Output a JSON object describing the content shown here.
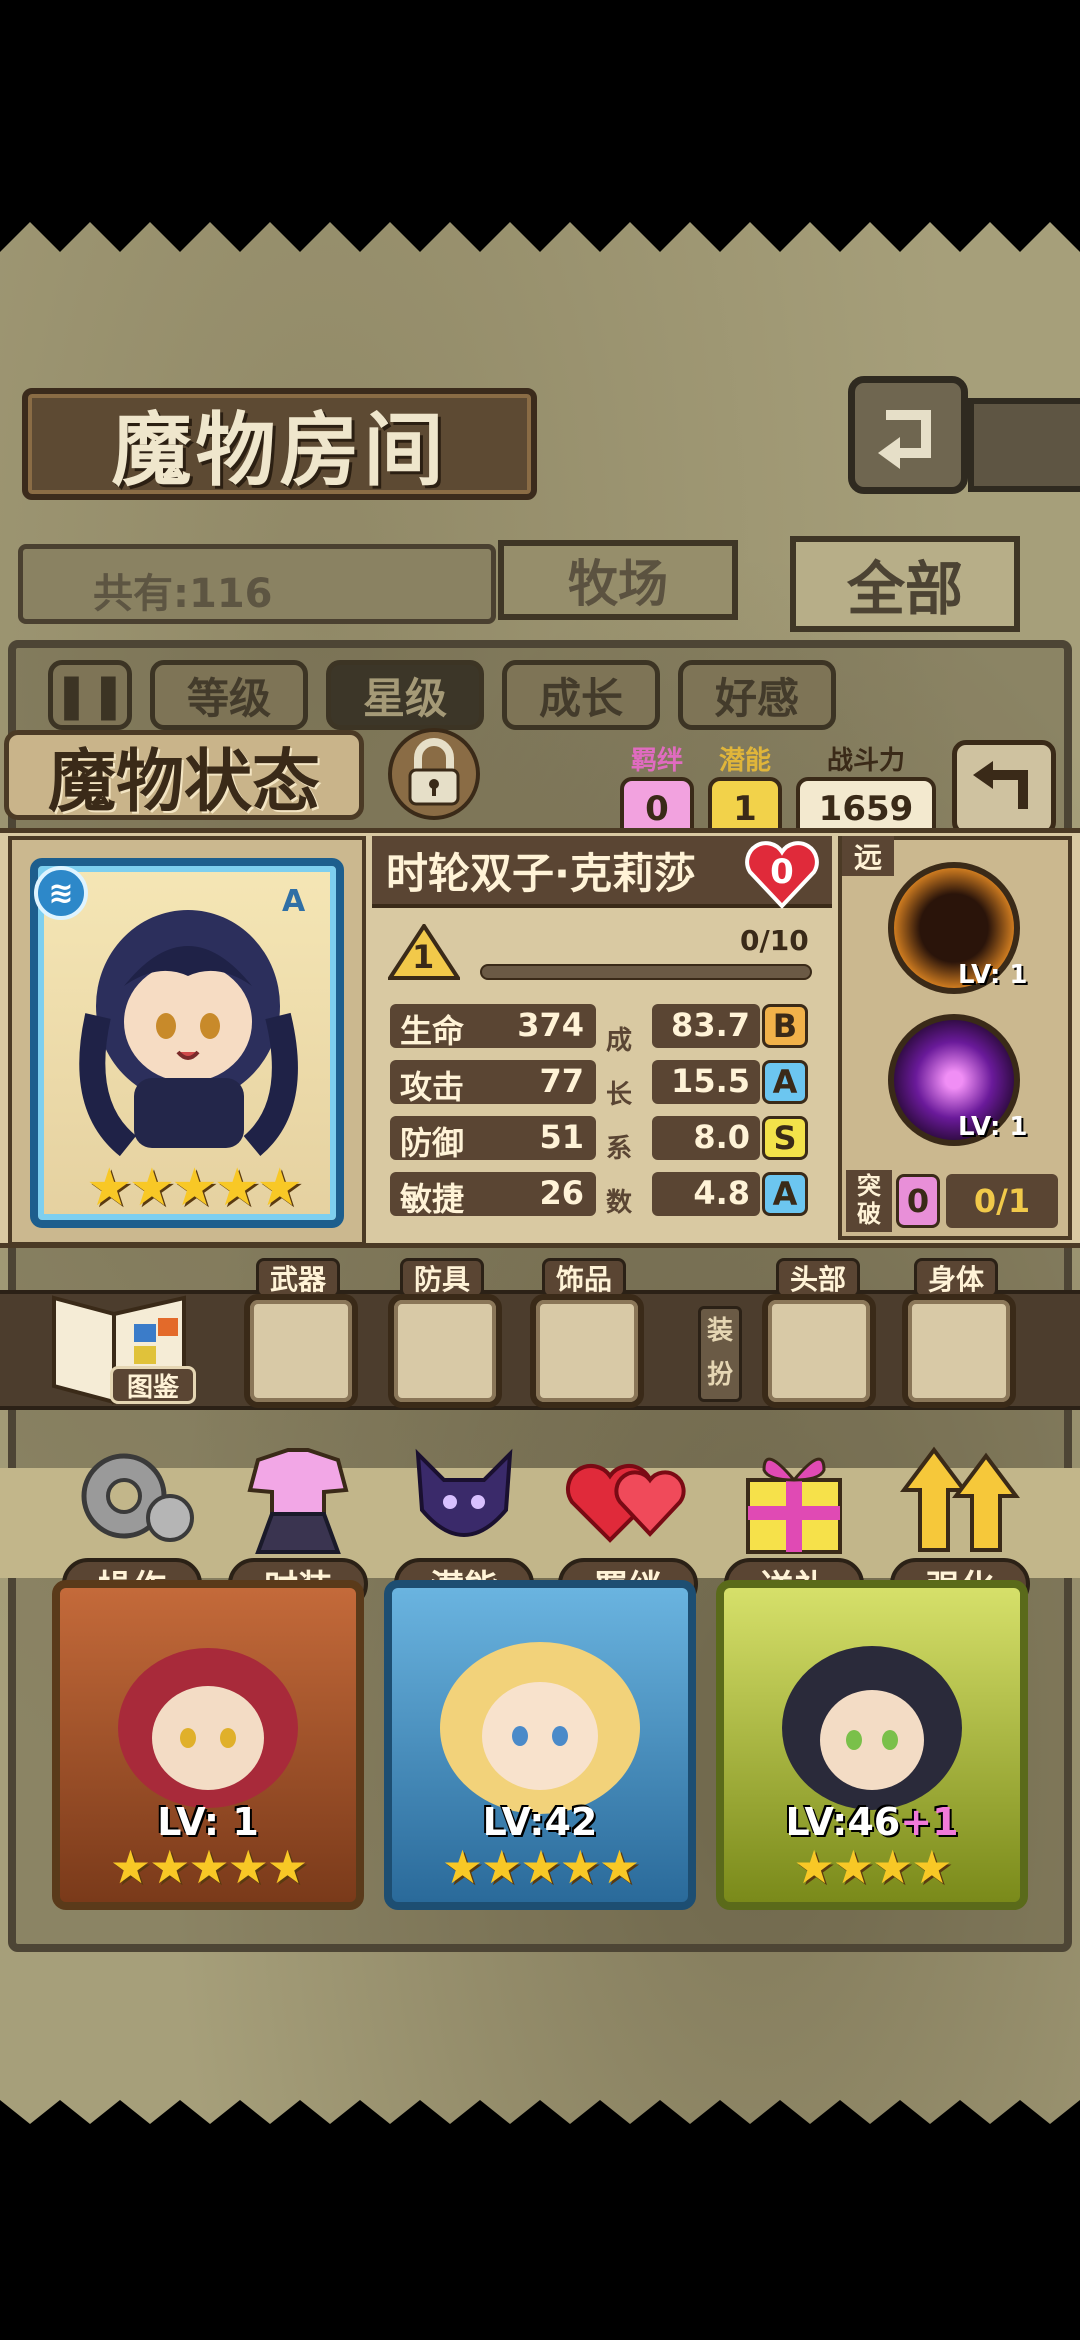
{
  "header": {
    "title": "魔物房间",
    "count_label": "共有:116",
    "tabs": [
      {
        "label": "牧场",
        "active": false
      },
      {
        "label": "全部",
        "active": true
      }
    ]
  },
  "filters": [
    {
      "label": "等级",
      "active": false
    },
    {
      "label": "星级",
      "active": true
    },
    {
      "label": "成长",
      "active": false
    },
    {
      "label": "好感",
      "active": false
    }
  ],
  "status": {
    "title": "魔物状态",
    "bond_label": "羁绊",
    "bond_value": "0",
    "potential_label": "潜能",
    "potential_value": "1",
    "power_label": "战斗力",
    "power_value": "1659",
    "monster_name": "时轮双子·克莉莎",
    "affection": "0",
    "rank_tag": "A",
    "level": "1",
    "exp": "0/10",
    "exp_fraction": 0.0,
    "star_count": 5,
    "stats": [
      {
        "name": "生命",
        "value": "374",
        "growth": "83.7",
        "grade": "B",
        "grade_color": "#f1b24a"
      },
      {
        "name": "攻击",
        "value": "77",
        "growth": "15.5",
        "grade": "A",
        "grade_color": "#6cc6f0"
      },
      {
        "name": "防御",
        "value": "51",
        "growth": "8.0",
        "grade": "S",
        "grade_color": "#f3e24a"
      },
      {
        "name": "敏捷",
        "value": "26",
        "growth": "4.8",
        "grade": "A",
        "grade_color": "#6cc6f0"
      }
    ],
    "growth_chars": [
      "成",
      "长",
      "系",
      "数"
    ],
    "range": "远",
    "skills": [
      {
        "name": "fire-skill-icon",
        "level": "LV: 1",
        "color": "#e58a23"
      },
      {
        "name": "spiral-skill-icon",
        "level": "LV: 1",
        "color": "#9b2fd0"
      }
    ],
    "break_label": "突破",
    "break_count": "0",
    "break_progress": "0/1"
  },
  "equipment": {
    "book_label": "图鉴",
    "slots": [
      "武器",
      "防具",
      "饰品",
      "头部",
      "身体"
    ],
    "dress_label": "装扮"
  },
  "actions": [
    "操作",
    "时装",
    "潜能",
    "羁绊",
    "送礼",
    "强化"
  ],
  "monsters": [
    {
      "level": "LV: 1",
      "stars": "★★★★★",
      "frame": "#a0662d"
    },
    {
      "level": "LV:42",
      "stars": "★★★★★",
      "frame": "#3b7ca8"
    },
    {
      "level": "LV:46",
      "bonus": "+1",
      "stars": "★★★★",
      "frame": "#8a9a2a"
    }
  ]
}
